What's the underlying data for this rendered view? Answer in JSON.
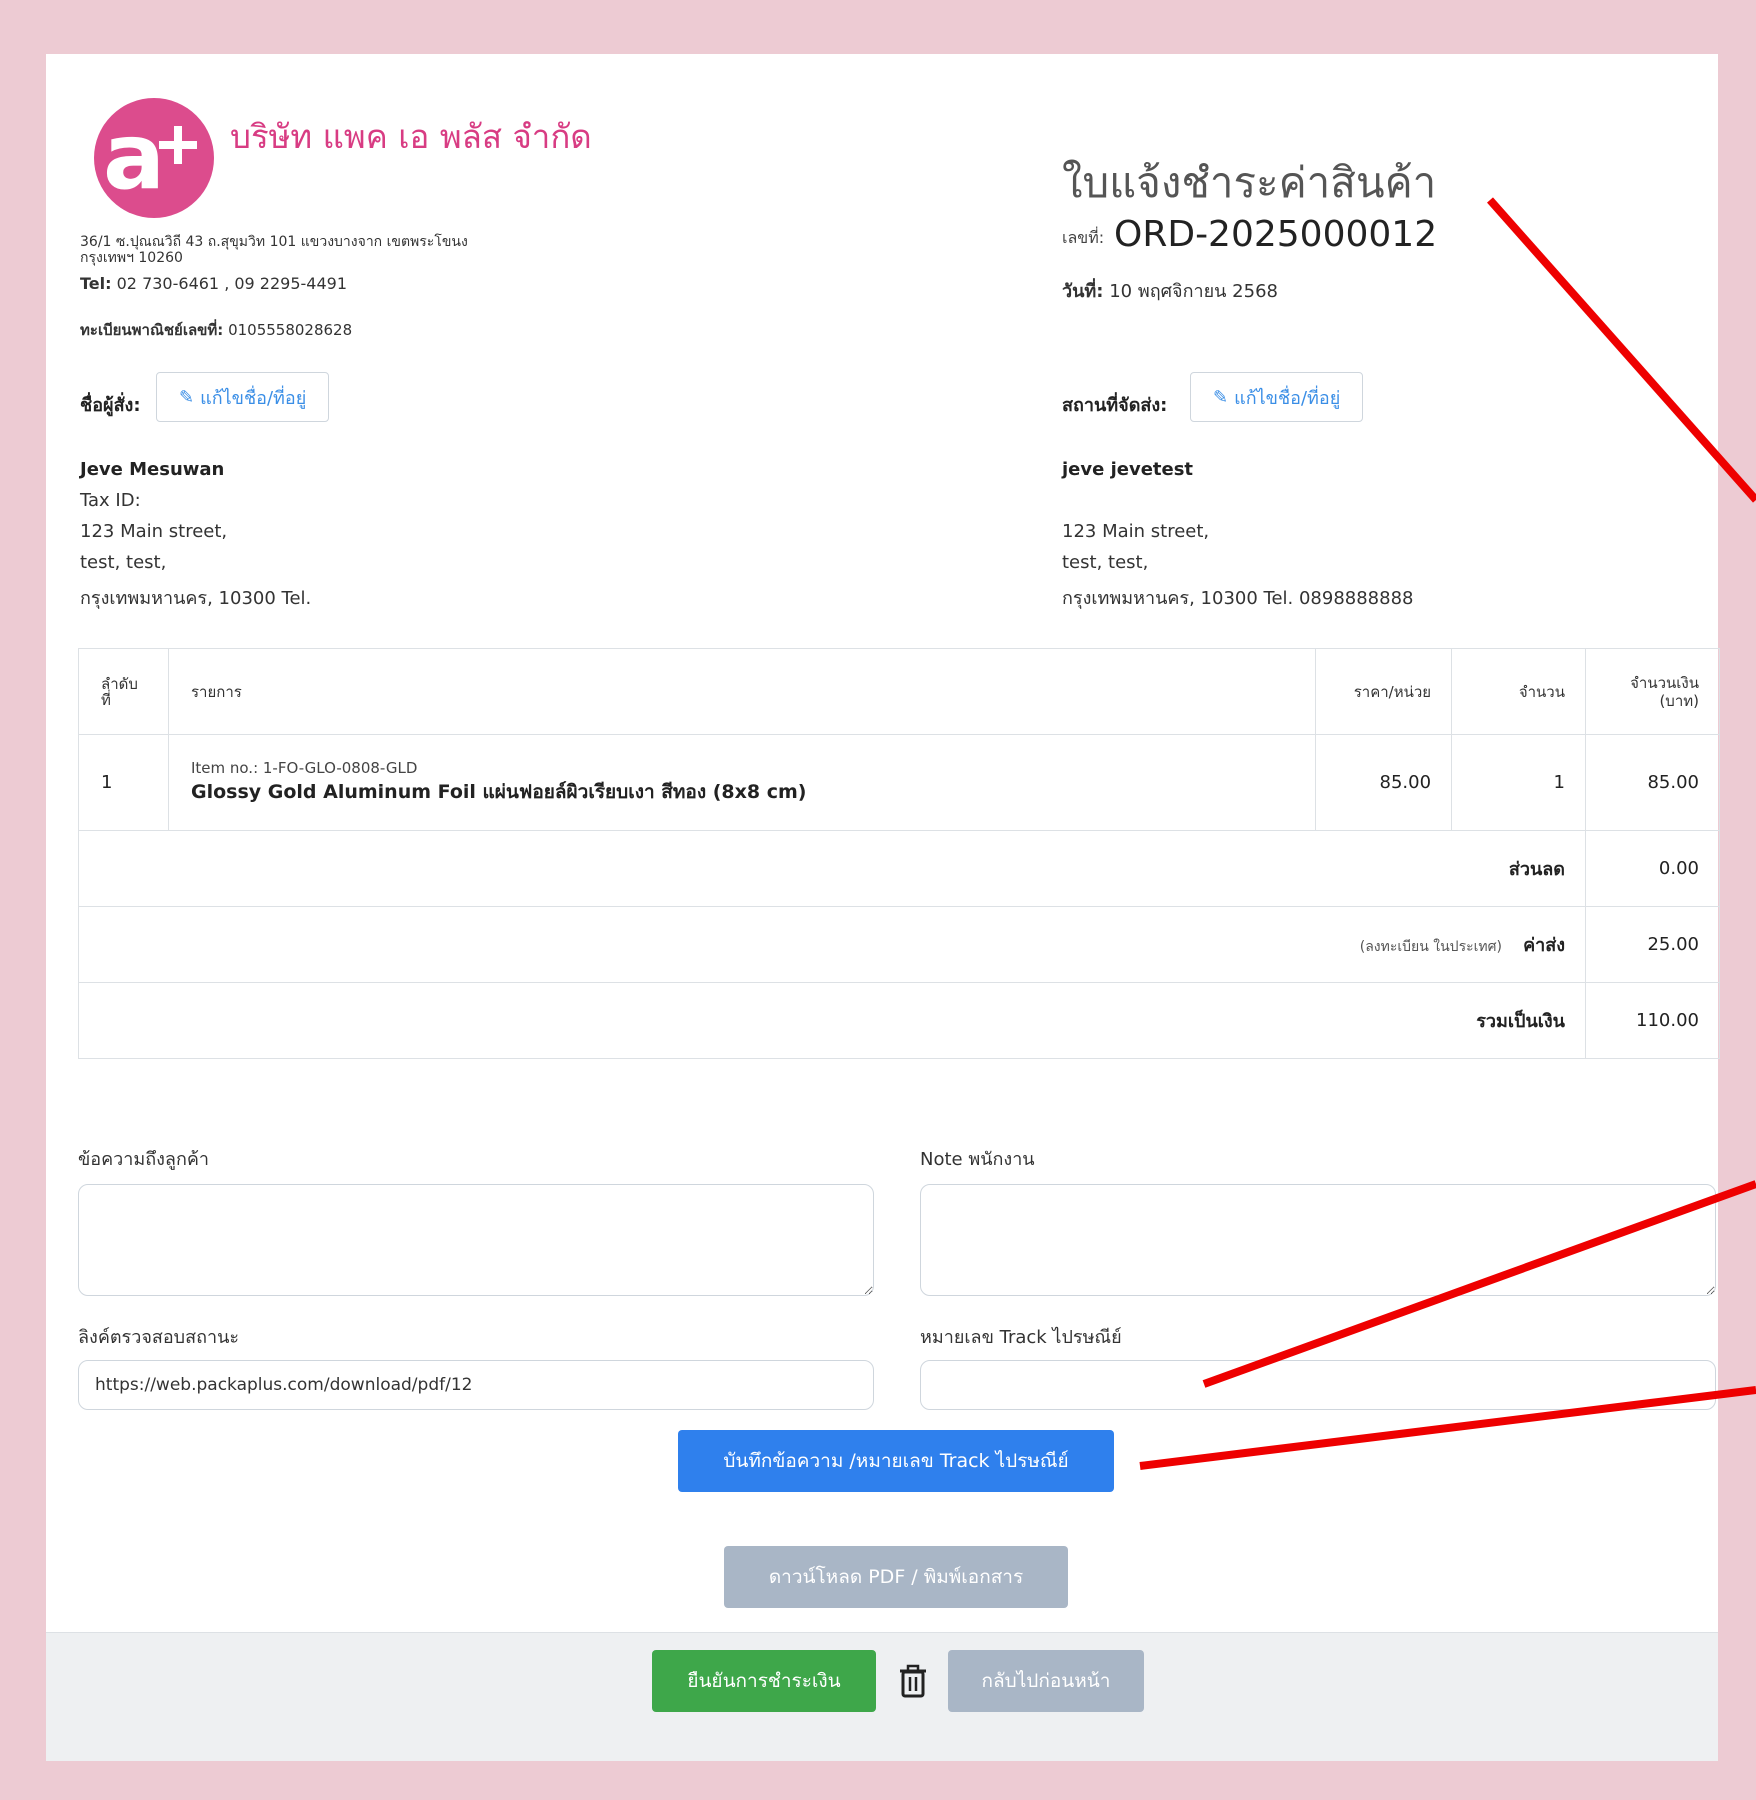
{
  "company": {
    "name": "บริษัท แพค เอ พลัส จำกัด",
    "address_line1": "36/1 ซ.ปุณณวิถี 43 ถ.สุขุมวิท 101 แขวงบางจาก เขตพระโขนง",
    "address_line2": "กรุงเทพฯ 10260",
    "tel_label": "Tel:",
    "tel_value": "02 730-6461 , 09 2295-4491",
    "reg_label": "ทะเบียนพาณิชย์เลขที่:",
    "reg_value": "0105558028628"
  },
  "document": {
    "title": "ใบแจ้งชำระค่าสินค้า",
    "no_label": "เลขที่:",
    "no_value": "ORD-2025000012",
    "date_label": "วันที่:",
    "date_value": "10 พฤศจิกายน 2568"
  },
  "buyer": {
    "label": "ชื่อผู้สั่ง:",
    "edit_label": "แก้ไขชื่อ/ที่อยู่",
    "name": "Jeve Mesuwan",
    "tax_id": "Tax ID:",
    "line1": "123 Main street,",
    "line2": "test, test,",
    "line3": "กรุงเทพมหานคร, 10300 Tel."
  },
  "shipping": {
    "label": "สถานที่จัดส่ง:",
    "edit_label": "แก้ไขชื่อ/ที่อยู่",
    "name": "jeve jevetest",
    "line1": "123 Main street,",
    "line2": "test, test,",
    "line3": "กรุงเทพมหานคร, 10300 Tel. 0898888888"
  },
  "table": {
    "headers": {
      "no_line1": "ลำดับ",
      "no_line2": "ที่",
      "item": "รายการ",
      "unit_price": "ราคา/หน่วย",
      "qty": "จำนวน",
      "amount_line1": "จำนวนเงิน",
      "amount_line2": "(บาท)"
    },
    "rows": [
      {
        "no": "1",
        "item_no": "Item no.: 1-FO-GLO-0808-GLD",
        "item_name": "Glossy Gold Aluminum Foil แผ่นฟอยล์ผิวเรียบเงา สีทอง (8x8 cm)",
        "unit_price": "85.00",
        "qty": "1",
        "amount": "85.00"
      }
    ],
    "discount_label": "ส่วนลด",
    "discount_value": "0.00",
    "shipping_note": "(ลงทะเบียน ในประเทศ)",
    "shipping_label": "ค่าส่ง",
    "shipping_value": "25.00",
    "total_label": "รวมเป็นเงิน",
    "total_value": "110.00"
  },
  "form": {
    "customer_msg_label": "ข้อความถึงลูกค้า",
    "staff_note_label": "Note พนักงาน",
    "status_link_label": "ลิงค์ตรวจสอบสถานะ",
    "status_link_value": "https://web.packaplus.com/download/pdf/12",
    "track_label": "หมายเลข Track ไปรษณีย์",
    "track_value": "",
    "save_button": "บันทึกข้อความ /หมายเลข Track ไปรษณีย์",
    "download_button": "ดาวน์โหลด PDF / พิมพ์เอกสาร"
  },
  "footer": {
    "confirm_button": "ยืนยันการชำระเงิน",
    "back_button": "กลับไปก่อนหน้า"
  },
  "colors": {
    "page_bg": "#edcbd3",
    "brand_pink": "#d83c83",
    "link_blue": "#3a8ee6",
    "primary_button": "#2f80ed",
    "success_button": "#3ea74a",
    "disabled_button": "#a9b6c6",
    "annotation_red": "#ee0000"
  }
}
